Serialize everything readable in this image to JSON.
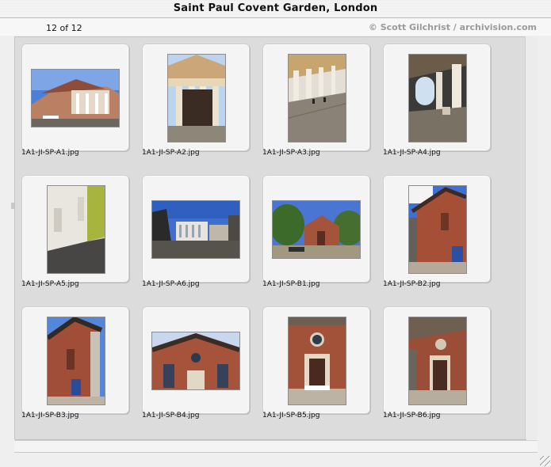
{
  "window": {
    "title": "Saint Paul Covent Garden, London"
  },
  "info": {
    "count": "12 of 12",
    "credit": "© Scott Gilchrist / archivision.com"
  },
  "gallery": {
    "items": [
      {
        "filename": "1A1-JI-SP-A1.jpg",
        "orientation": "landscape",
        "scene": "portico-exterior-sky"
      },
      {
        "filename": "1A1-JI-SP-A2.jpg",
        "orientation": "portrait",
        "scene": "portico-columns-front"
      },
      {
        "filename": "1A1-JI-SP-A3.jpg",
        "orientation": "portrait",
        "scene": "colonnade-perspective"
      },
      {
        "filename": "1A1-JI-SP-A4.jpg",
        "orientation": "portrait",
        "scene": "under-portico-arches"
      },
      {
        "filename": "1A1-JI-SP-A5.jpg",
        "orientation": "portrait",
        "scene": "side-wall-shadow"
      },
      {
        "filename": "1A1-JI-SP-A6.jpg",
        "orientation": "landscape",
        "scene": "piazza-view"
      },
      {
        "filename": "1A1-JI-SP-B1.jpg",
        "orientation": "landscape",
        "scene": "churchyard-garden"
      },
      {
        "filename": "1A1-JI-SP-B2.jpg",
        "orientation": "portrait",
        "scene": "brick-east-end"
      },
      {
        "filename": "1A1-JI-SP-B3.jpg",
        "orientation": "portrait",
        "scene": "brick-west-end"
      },
      {
        "filename": "1A1-JI-SP-B4.jpg",
        "orientation": "landscape",
        "scene": "brick-pediment"
      },
      {
        "filename": "1A1-JI-SP-B5.jpg",
        "orientation": "portrait",
        "scene": "brick-doorway"
      },
      {
        "filename": "1A1-JI-SP-B6.jpg",
        "orientation": "portrait",
        "scene": "brick-doorway-angle"
      }
    ]
  },
  "colors": {
    "credit_text": "#9a9a9a",
    "pane_bg": "#dcdcdc",
    "brick": "#a0513a",
    "sky": "#3d6fd0"
  }
}
